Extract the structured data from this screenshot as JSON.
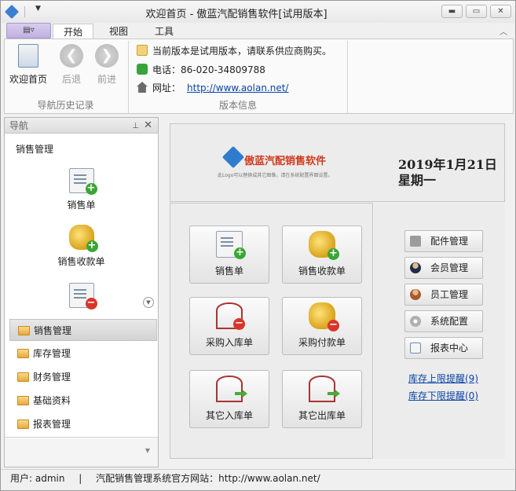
{
  "window": {
    "title": "欢迎首页 - 傲蓝汽配销售软件[试用版本]",
    "quick_access_dropdown": "▼",
    "minimize": "▬",
    "maximize": "▭",
    "close": "✕"
  },
  "ribbon": {
    "app_button": "▤▿",
    "tabs": [
      "开始",
      "视图",
      "工具"
    ],
    "collapse": "︿",
    "nav_group": {
      "buttons": [
        {
          "label": "欢迎首页",
          "icon": "home-icon"
        },
        {
          "label": "后退",
          "icon": "back-arrow-icon"
        },
        {
          "label": "前进",
          "icon": "forward-arrow-icon"
        }
      ],
      "label": "导航历史记录"
    },
    "version_group": {
      "notice": "当前版本是试用版本，请联系供应商购买。",
      "phone_label": "电话：",
      "phone": "86-020-34809788",
      "web_label": "网址：",
      "url": "http://www.aolan.net/",
      "label": "版本信息"
    }
  },
  "nav_panel": {
    "title": "导航",
    "pin": "📌",
    "close": "✕",
    "category": "销售管理",
    "items": [
      {
        "label": "销售单",
        "icon": "sales-order-icon"
      },
      {
        "label": "销售收款单",
        "icon": "sales-receipt-icon"
      },
      {
        "label": "",
        "icon": "sales-return-icon"
      }
    ],
    "scroll_down": "▼",
    "groups": [
      "销售管理",
      "库存管理",
      "财务管理",
      "基础资料",
      "报表管理"
    ],
    "footer_dropdown": "▼"
  },
  "header_panel": {
    "logo_text": "傲蓝汽配销售软件",
    "logo_subtext": "此Logo可以替换成其它图像，请在系统配置界面设置。",
    "date": "2019年1月21日",
    "weekday": "星期一"
  },
  "shortcuts": [
    {
      "label": "销售单",
      "icon": "sales-order-icon"
    },
    {
      "label": "销售收款单",
      "icon": "sales-receipt-icon"
    },
    {
      "label": "采购入库单",
      "icon": "purchase-in-icon"
    },
    {
      "label": "采购付款单",
      "icon": "purchase-payment-icon"
    },
    {
      "label": "其它入库单",
      "icon": "other-in-icon"
    },
    {
      "label": "其它出库单",
      "icon": "other-out-icon"
    }
  ],
  "side_buttons": [
    {
      "label": "配件管理",
      "icon": "parts-icon"
    },
    {
      "label": "会员管理",
      "icon": "member-icon"
    },
    {
      "label": "员工管理",
      "icon": "staff-icon"
    },
    {
      "label": "系统配置",
      "icon": "settings-gear-icon"
    },
    {
      "label": "报表中心",
      "icon": "report-icon"
    }
  ],
  "stock_links": [
    "库存上限提醒(9)",
    "库存下限提醒(0)"
  ],
  "status_bar": {
    "user_label": "用户: admin",
    "separator": "|",
    "site_text": "汽配销售管理系统官方网站：http://www.aolan.net/"
  },
  "colors": {
    "accent": "#3a7fd0",
    "link": "#0b44a8",
    "logo_red": "#d23a1e"
  }
}
